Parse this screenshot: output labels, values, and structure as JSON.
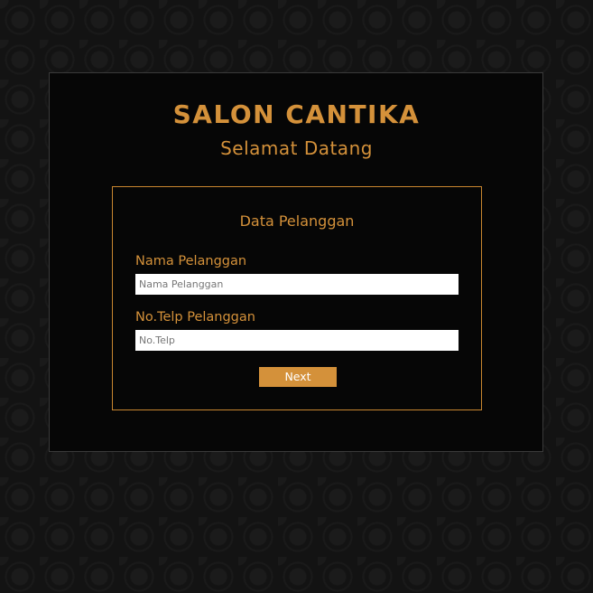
{
  "header": {
    "title": "SALON CANTIKA",
    "subtitle": "Selamat Datang"
  },
  "form": {
    "title": "Data Pelanggan",
    "name_field": {
      "label": "Nama Pelanggan",
      "placeholder": "Nama Pelanggan",
      "value": ""
    },
    "phone_field": {
      "label": "No.Telp Pelanggan",
      "placeholder": "No.Telp",
      "value": ""
    },
    "next_label": "Next"
  },
  "colors": {
    "accent": "#d4913a",
    "background": "#131313",
    "panel": "#060606"
  }
}
